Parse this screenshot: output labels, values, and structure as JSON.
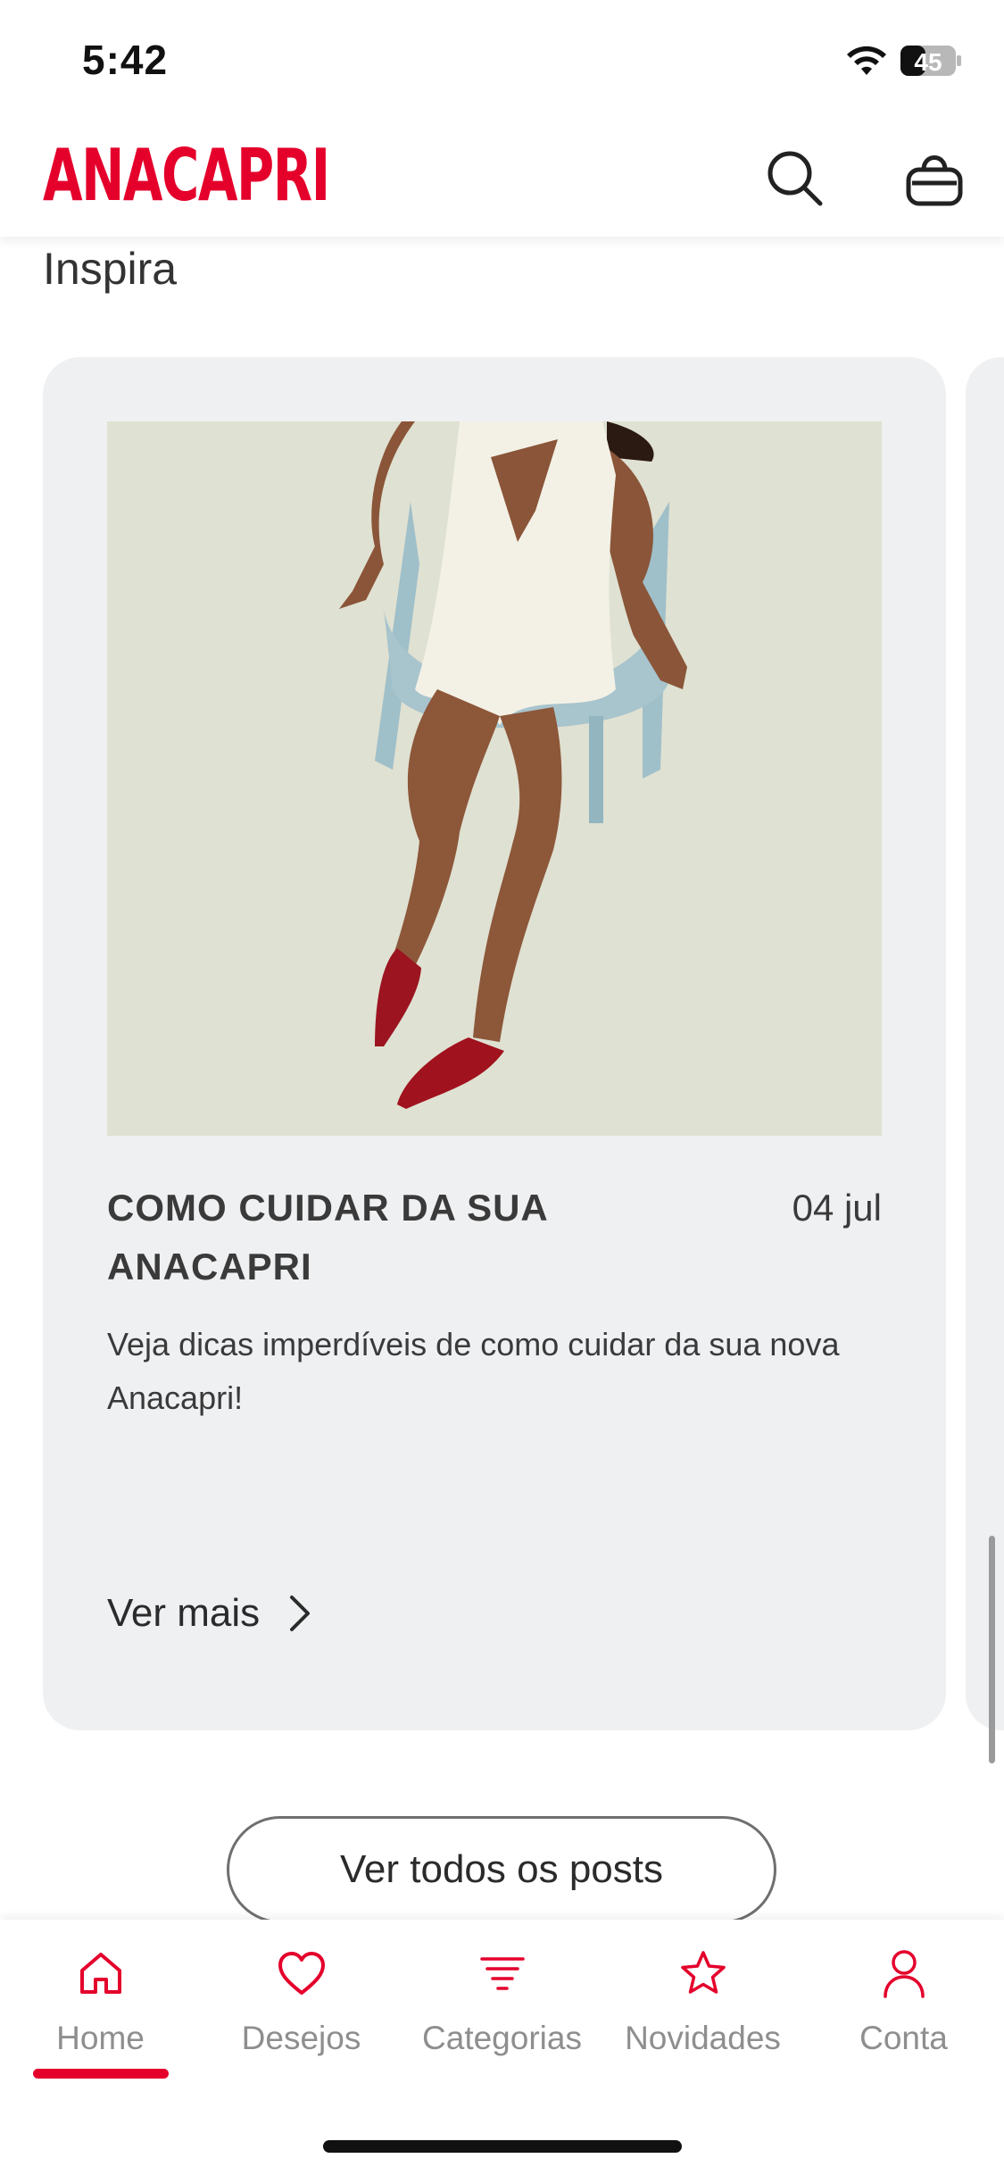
{
  "status_bar": {
    "time": "5:42",
    "battery": "45"
  },
  "header": {
    "logo": "ANACAPRI",
    "brand_color": "#e4002b",
    "icons": [
      "search-icon",
      "shopping-bag-icon"
    ]
  },
  "section": {
    "title": "Inspira"
  },
  "post": {
    "title": "COMO CUIDAR DA SUA ANACAPRI",
    "date": "04 jul",
    "description": "Veja dicas imperdíveis de como cuidar da sua nova Anacapri!",
    "link_label": "Ver mais"
  },
  "all_posts_button": "Ver todos os posts",
  "bottom_nav": {
    "items": [
      {
        "label": "Home",
        "icon": "home-icon",
        "active": true
      },
      {
        "label": "Desejos",
        "icon": "heart-icon",
        "active": false
      },
      {
        "label": "Categorias",
        "icon": "filter-lines-icon",
        "active": false
      },
      {
        "label": "Novidades",
        "icon": "star-icon",
        "active": false
      },
      {
        "label": "Conta",
        "icon": "user-icon",
        "active": false
      }
    ]
  }
}
